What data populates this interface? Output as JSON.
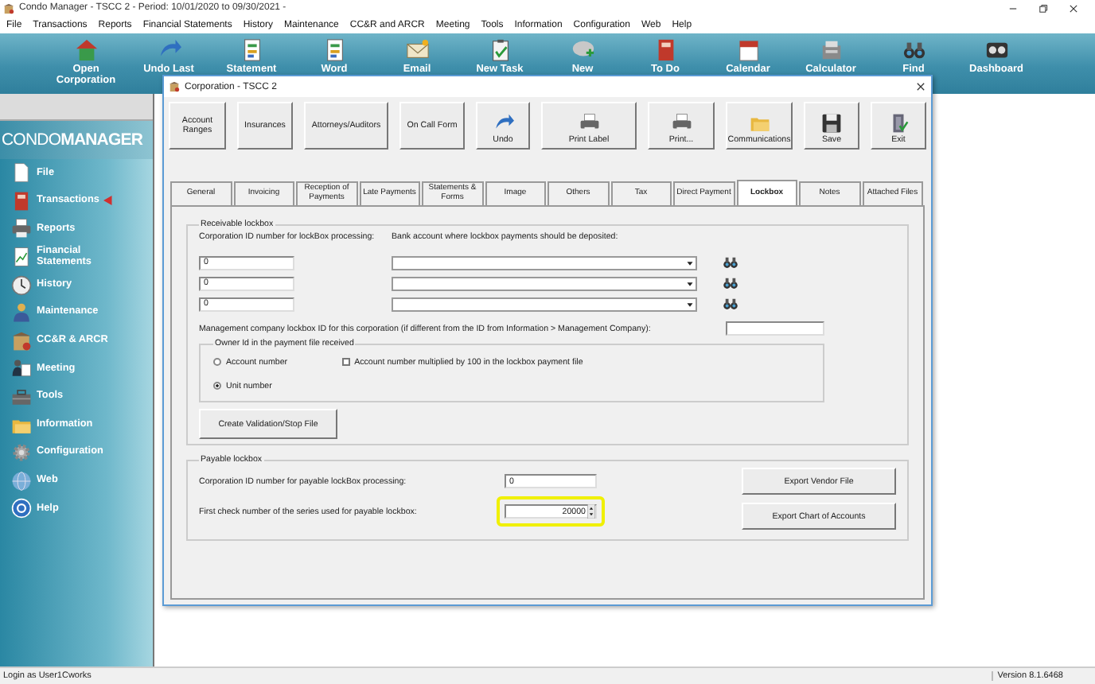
{
  "app": {
    "title": "Condo Manager - TSCC 2 - Period: 10/01/2020 to 09/30/2021 -"
  },
  "menu": [
    "File",
    "Transactions",
    "Reports",
    "Financial Statements",
    "History",
    "Maintenance",
    "CC&R and ARCR",
    "Meeting",
    "Tools",
    "Information",
    "Configuration",
    "Web",
    "Help"
  ],
  "toolbar": [
    {
      "label": "Open Corporation"
    },
    {
      "label": "Undo Last"
    },
    {
      "label": "Statement"
    },
    {
      "label": "Word"
    },
    {
      "label": "Email"
    },
    {
      "label": "New Task"
    },
    {
      "label": "New"
    },
    {
      "label": "To Do"
    },
    {
      "label": "Calendar"
    },
    {
      "label": "Calculator"
    },
    {
      "label": "Find"
    },
    {
      "label": "Dashboard"
    }
  ],
  "sidebar": {
    "logo": "CONDO**MANAGER**",
    "items": [
      {
        "label": "File",
        "selected": false
      },
      {
        "label": "Transactions",
        "selected": true
      },
      {
        "label": "Reports",
        "selected": false
      },
      {
        "label": "Financial Statements",
        "selected": false
      },
      {
        "label": "History",
        "selected": false
      },
      {
        "label": "Maintenance",
        "selected": false
      },
      {
        "label": "CC&R & ARCR",
        "selected": false
      },
      {
        "label": "Meeting",
        "selected": false
      },
      {
        "label": "Tools",
        "selected": false
      },
      {
        "label": "Information",
        "selected": false
      },
      {
        "label": "Configuration",
        "selected": false
      },
      {
        "label": "Web",
        "selected": false
      },
      {
        "label": "Help",
        "selected": false
      }
    ]
  },
  "dialog": {
    "title": "Corporation - TSCC 2",
    "buttons": [
      {
        "label": "Account Ranges",
        "kind": "text"
      },
      {
        "label": "Insurances",
        "kind": "text"
      },
      {
        "label": "Attorneys/Auditors",
        "kind": "text"
      },
      {
        "label": "On Call Form",
        "kind": "text"
      },
      {
        "label": "Undo",
        "kind": "icon"
      },
      {
        "label": "Print Label",
        "kind": "icon"
      },
      {
        "label": "Print...",
        "kind": "icon"
      },
      {
        "label": "Communications",
        "kind": "icon"
      },
      {
        "label": "Save",
        "kind": "icon"
      },
      {
        "label": "Exit",
        "kind": "icon"
      }
    ],
    "tabs": [
      {
        "label": "General",
        "selected": false
      },
      {
        "label": "Invoicing",
        "selected": false
      },
      {
        "label": "Reception of Payments",
        "selected": false
      },
      {
        "label": "Late Payments",
        "selected": false
      },
      {
        "label": "Statements & Forms",
        "selected": false
      },
      {
        "label": "Image",
        "selected": false
      },
      {
        "label": "Others",
        "selected": false
      },
      {
        "label": "Tax",
        "selected": false
      },
      {
        "label": "Direct Payment",
        "selected": false
      },
      {
        "label": "Lockbox",
        "selected": true
      },
      {
        "label": "Notes",
        "selected": false
      },
      {
        "label": "Attached Files",
        "selected": false
      }
    ],
    "receivable": {
      "title": "Receivable lockbox",
      "id_label": "Corporation ID number for lockBox processing:",
      "bank_label": "Bank account where lockbox payments should be deposited:",
      "rows": [
        {
          "id": "0"
        },
        {
          "id": "0"
        },
        {
          "id": "0"
        }
      ],
      "mgmt_label": "Management company lockbox ID for this corporation (if different from the ID from Information > Management Company):",
      "owner": {
        "title": "Owner Id in the payment file received",
        "options": [
          {
            "label": "Account number",
            "selected": false
          },
          {
            "label": "Unit number",
            "selected": true
          }
        ],
        "checkbox": {
          "label": "Account number multiplied by 100 in the lockbox payment file",
          "checked": false
        }
      },
      "create_button": "Create Validation/Stop File"
    },
    "payable": {
      "title": "Payable lockbox",
      "fields": [
        {
          "label": "Corporation ID number for payable lockBox processing:",
          "value": "0",
          "kind": "text",
          "highlighted": false
        },
        {
          "label": "First check number of the series used for payable lockbox:",
          "value": "20000",
          "kind": "spin",
          "highlighted": true
        }
      ],
      "buttons": [
        "Export Vendor File",
        "Export Chart of Accounts"
      ]
    }
  },
  "status_bar": {
    "login": "Login as User1Cworks",
    "version": "Version 8.1.6468"
  }
}
